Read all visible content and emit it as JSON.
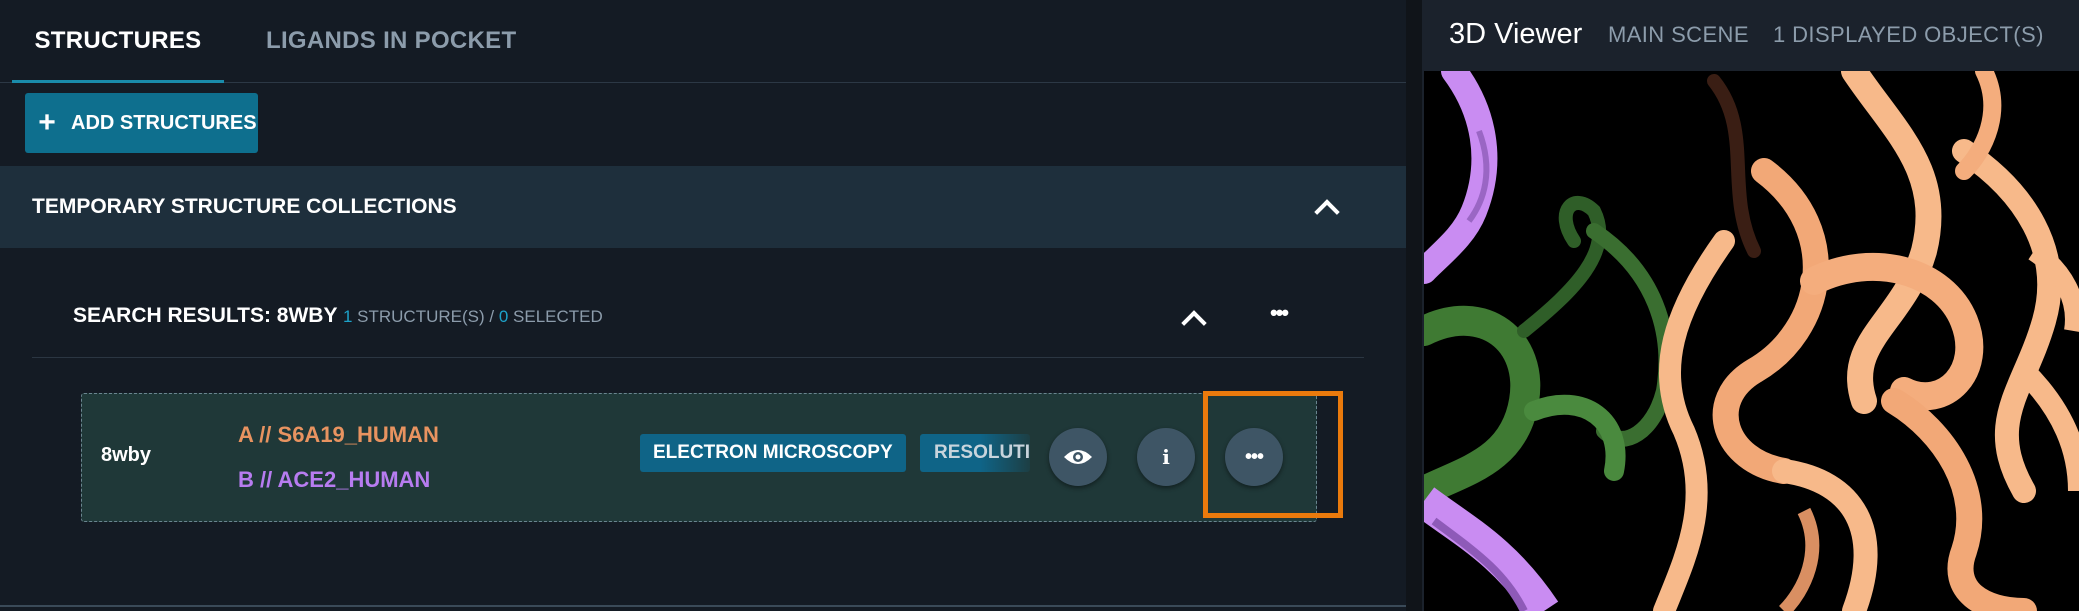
{
  "tabs": [
    {
      "label": "STRUCTURES",
      "active": true
    },
    {
      "label": "LIGANDS IN POCKET",
      "active": false
    }
  ],
  "toolbar": {
    "add_label": "ADD STRUCTURES"
  },
  "collections": {
    "title": "TEMPORARY STRUCTURE COLLECTIONS",
    "search": {
      "title": "SEARCH RESULTS: 8WBY",
      "structures_count": "1",
      "structures_label": "STRUCTURE(S) /",
      "selected_count": "0",
      "selected_label": "SELECTED"
    }
  },
  "structure": {
    "code": "8wby",
    "chain_a": "A // S6A19_HUMAN",
    "chain_b": "B // ACE2_HUMAN",
    "method": "ELECTRON MICROSCOPY",
    "resolution_label": "RESOLUTION"
  },
  "viewer": {
    "title": "3D Viewer",
    "scene": "MAIN SCENE",
    "objects": "1 DISPLAYED OBJECT(S)"
  },
  "colors": {
    "accent": "#0e6f8e",
    "highlight": "#ea7a0c",
    "chain_a": "#e89360",
    "chain_b": "#b77cf0",
    "ribbon_peach": "#f7b98a",
    "ribbon_green": "#3f7a33",
    "ribbon_violet": "#c98cf2"
  },
  "icons": [
    "plus-icon",
    "chevron-up-icon",
    "more-horizontal-icon",
    "eye-icon",
    "info-icon"
  ]
}
